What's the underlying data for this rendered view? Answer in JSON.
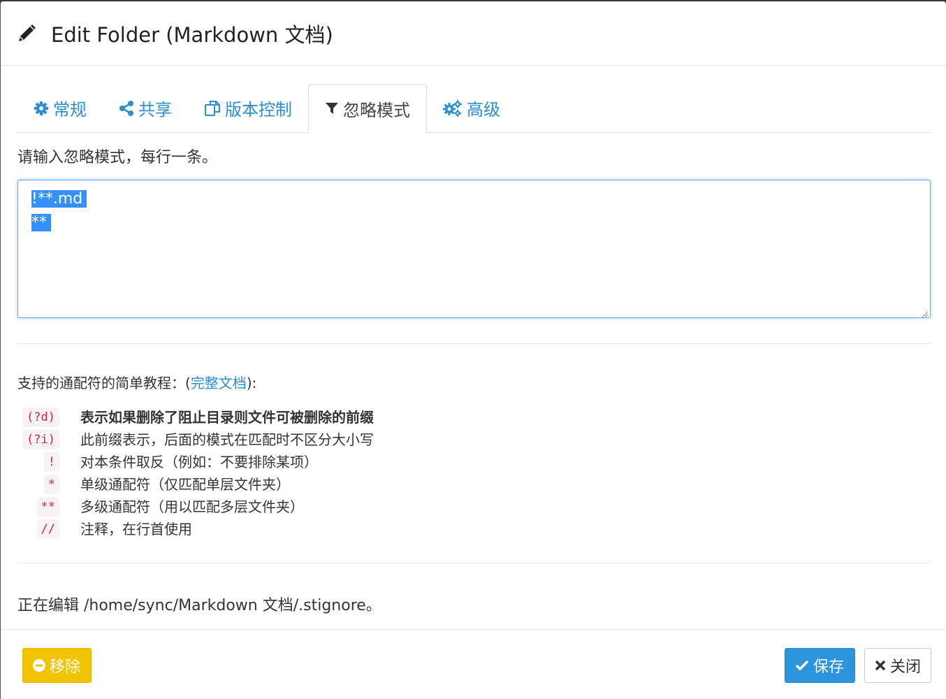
{
  "dialog": {
    "title": "Edit Folder (Markdown 文档)"
  },
  "tabs": [
    {
      "label": "常规",
      "icon": "gear-icon"
    },
    {
      "label": "共享",
      "icon": "share-icon"
    },
    {
      "label": "版本控制",
      "icon": "copy-icon"
    },
    {
      "label": "忽略模式",
      "icon": "filter-icon",
      "active": true
    },
    {
      "label": "高级",
      "icon": "gears-icon"
    }
  ],
  "ignore": {
    "instructions": "请输入忽略模式，每行一条。",
    "lines": [
      "!**.md",
      "**"
    ]
  },
  "help": {
    "intro_prefix": "支持的通配符的简单教程：",
    "intro_open": "(",
    "intro_link": "完整文档",
    "intro_close": "):",
    "rules": [
      {
        "code": "(?d)",
        "desc": "表示如果删除了阻止目录则文件可被删除的前缀"
      },
      {
        "code": "(?i)",
        "desc": "此前缀表示，后面的模式在匹配时不区分大小写"
      },
      {
        "code": "!",
        "desc": "对本条件取反（例如：不要排除某项）"
      },
      {
        "code": "*",
        "desc": "单级通配符（仅匹配单层文件夹）"
      },
      {
        "code": "**",
        "desc": "多级通配符（用以匹配多层文件夹）"
      },
      {
        "code": "//",
        "desc": "注释，在行首使用"
      }
    ]
  },
  "editing_path": "正在编辑 /home/sync/Markdown 文档/.stignore。",
  "footer": {
    "remove_label": "移除",
    "save_label": "保存",
    "close_label": "关闭"
  },
  "colors": {
    "link": "#2a8fd1",
    "remove_button": "#f0c400",
    "save_button": "#2a95dd",
    "selection": "#3390ff",
    "code_text": "#c7254e"
  }
}
